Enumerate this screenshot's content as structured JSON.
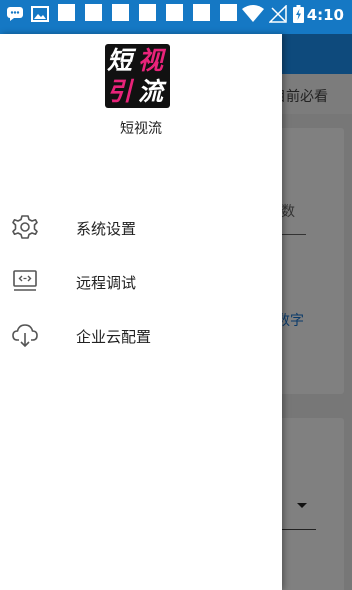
{
  "status_bar": {
    "time": "4:10",
    "icons": [
      "chat-icon",
      "image-icon",
      "app-square-icon",
      "app-square-icon",
      "app-square-icon",
      "app-square-icon",
      "app-square-icon",
      "app-square-icon",
      "app-square-icon",
      "wifi-icon",
      "no-signal-icon",
      "battery-charging-icon"
    ]
  },
  "background": {
    "tab_text": "目前必看",
    "field_placeholder": "数",
    "link_text": "数字"
  },
  "drawer": {
    "logo_chars": [
      "短",
      "视",
      "引",
      "流"
    ],
    "app_name": "短视流",
    "menu": [
      {
        "label": "系统设置",
        "icon": "settings-gear-icon"
      },
      {
        "label": "远程调试",
        "icon": "remote-debug-icon"
      },
      {
        "label": "企业云配置",
        "icon": "cloud-download-icon"
      }
    ]
  },
  "colors": {
    "status_bar": "#1578c4",
    "appbar": "#0e4a7c",
    "logo_accent": "#e9237a",
    "drawer_bg": "#ffffff"
  }
}
